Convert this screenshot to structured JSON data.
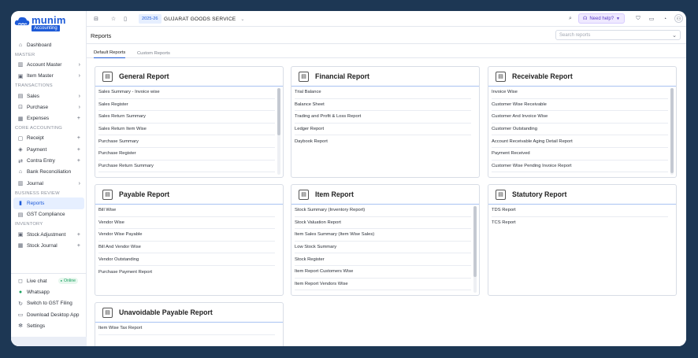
{
  "app": {
    "logo_name": "munim",
    "logo_badge": "Accounting"
  },
  "topbar": {
    "year": "2025-26",
    "company": "GUJARAT GOODS SERVICE",
    "help": "Need help?"
  },
  "header": {
    "title": "Reports",
    "search_placeholder": "Search reports"
  },
  "tabs": [
    {
      "label": "Default Reports"
    },
    {
      "label": "Custom Reports"
    }
  ],
  "sidebar": {
    "dashboard": "Dashboard",
    "master_section": "MASTER",
    "account_master": "Account Master",
    "item_master": "Item Master",
    "transactions_section": "TRANSACTIONS",
    "sales": "Sales",
    "purchase": "Purchase",
    "expenses": "Expenses",
    "core_section": "CORE ACCOUNTING",
    "receipt": "Receipt",
    "payment": "Payment",
    "contra": "Contra Entry",
    "bank_rec": "Bank Reconciliation",
    "journal": "Journal",
    "business_section": "BUSINESS REVIEW",
    "reports": "Reports",
    "gst": "GST Compliance",
    "inventory_section": "INVENTORY",
    "stock_adj": "Stock Adjustment",
    "stock_journal": "Stock Journal",
    "live_chat": "Live chat",
    "online": "Online",
    "whatsapp": "Whatsapp",
    "switch_gst": "Switch to GST Filing",
    "download": "Download Desktop App",
    "settings": "Settings"
  },
  "cards": {
    "general": {
      "title": "General Report",
      "items": [
        "Sales Summary - Invoice wise",
        "Sales Register",
        "Sales Return Summary",
        "Sales Return Item Wise",
        "Purchase Summary",
        "Purchase Register",
        "Purchase Return Summary"
      ]
    },
    "financial": {
      "title": "Financial Report",
      "items": [
        "Trial Balance",
        "Balance Sheet",
        "Trading and Profit & Loss Report",
        "Ledger Report",
        "Daybook Report"
      ]
    },
    "receivable": {
      "title": "Receivable Report",
      "items": [
        "Invoice Wise",
        "Customer Wise Receivable",
        "Customer And Invoice Wise",
        "Customer Outstanding",
        "Account Receivable Aging Detail Report",
        "Payment Received",
        "Customer Wise Pending Invoice Report"
      ]
    },
    "payable": {
      "title": "Payable Report",
      "items": [
        "Bill Wise",
        "Vendor Wise",
        "Vendor Wise Payable",
        "Bill And Vendor Wise",
        "Vendor Outstanding",
        "Purchase Payment Report"
      ]
    },
    "item": {
      "title": "Item Report",
      "items": [
        "Stock Summary (Inventory Report)",
        "Stock Valuation Report",
        "Item Sales Summary (Item Wise Sales)",
        "Low Stock Summary",
        "Stock Register",
        "Item Report Customers Wise",
        "Item Report Vendors Wise"
      ]
    },
    "statutory": {
      "title": "Statutory Report",
      "items": [
        "TDS Report",
        "TCS Report"
      ]
    },
    "unavoidable": {
      "title": "Unavoidable Payable Report",
      "items": [
        "Item Wise Tax Report"
      ]
    }
  }
}
